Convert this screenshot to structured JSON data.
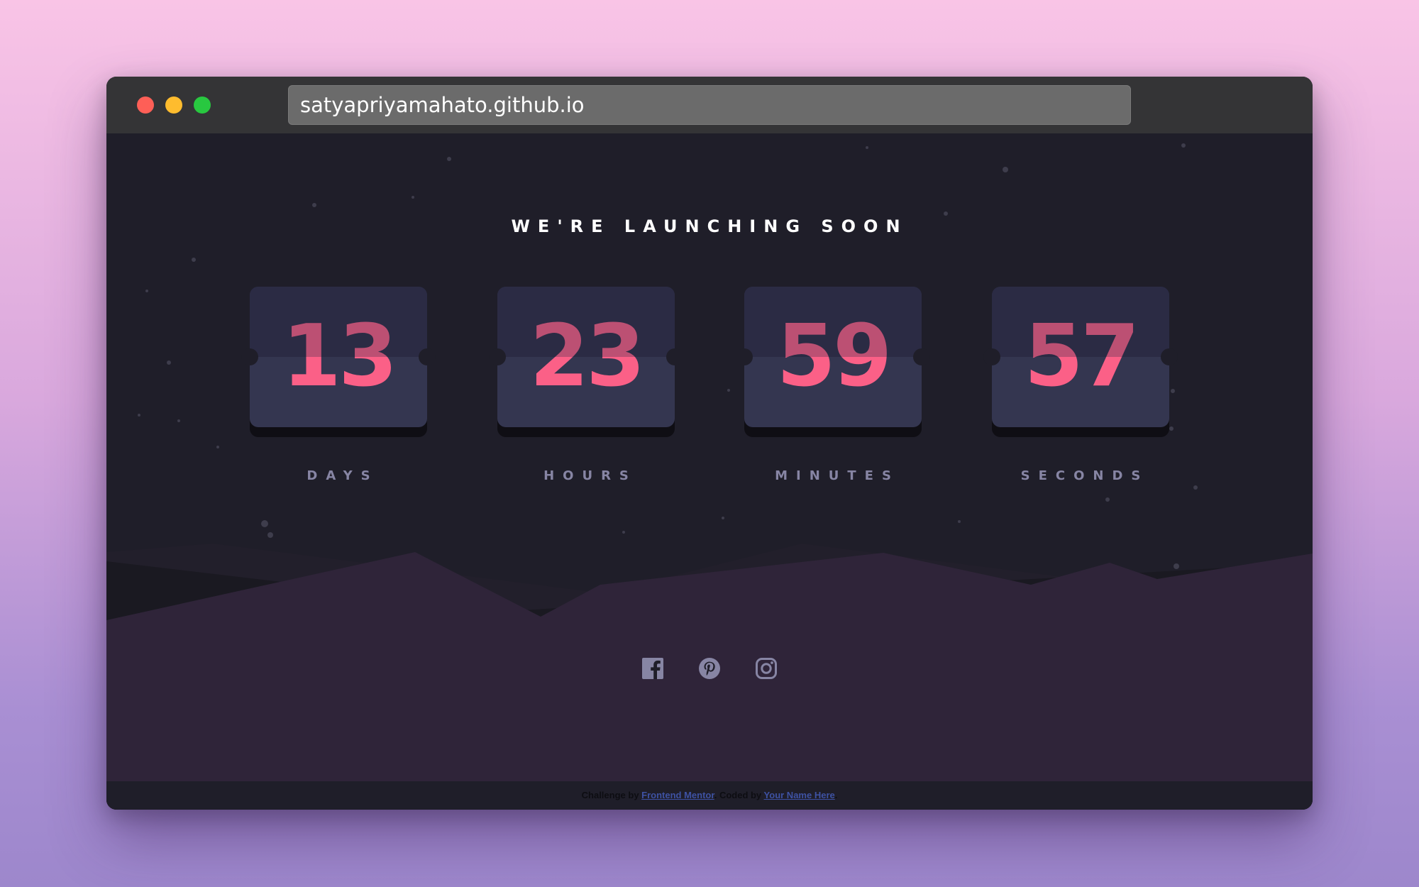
{
  "browser": {
    "url": "satyapriyamahato.github.io",
    "traffic_lights": {
      "close": "#fe5f57",
      "minimize": "#febc2e",
      "maximize": "#28c840"
    }
  },
  "page": {
    "headline": "WE'RE LAUNCHING SOON",
    "countdown": [
      {
        "value": "13",
        "label": "DAYS"
      },
      {
        "value": "23",
        "label": "HOURS"
      },
      {
        "value": "59",
        "label": "MINUTES"
      },
      {
        "value": "57",
        "label": "SECONDS"
      }
    ],
    "socials": [
      {
        "icon": "facebook-icon"
      },
      {
        "icon": "pinterest-icon"
      },
      {
        "icon": "instagram-icon"
      }
    ],
    "footer": {
      "prefix": "Challenge by ",
      "link1": "Frontend Mentor",
      "middle": ". Coded by ",
      "link2": "Your Name Here",
      "suffix": "."
    },
    "colors": {
      "background": "#1f1e29",
      "number": "#fb6087",
      "label": "#8785a4",
      "card": "#343650",
      "hills": "#2f2439",
      "accent_link": "#3e52a3"
    }
  }
}
